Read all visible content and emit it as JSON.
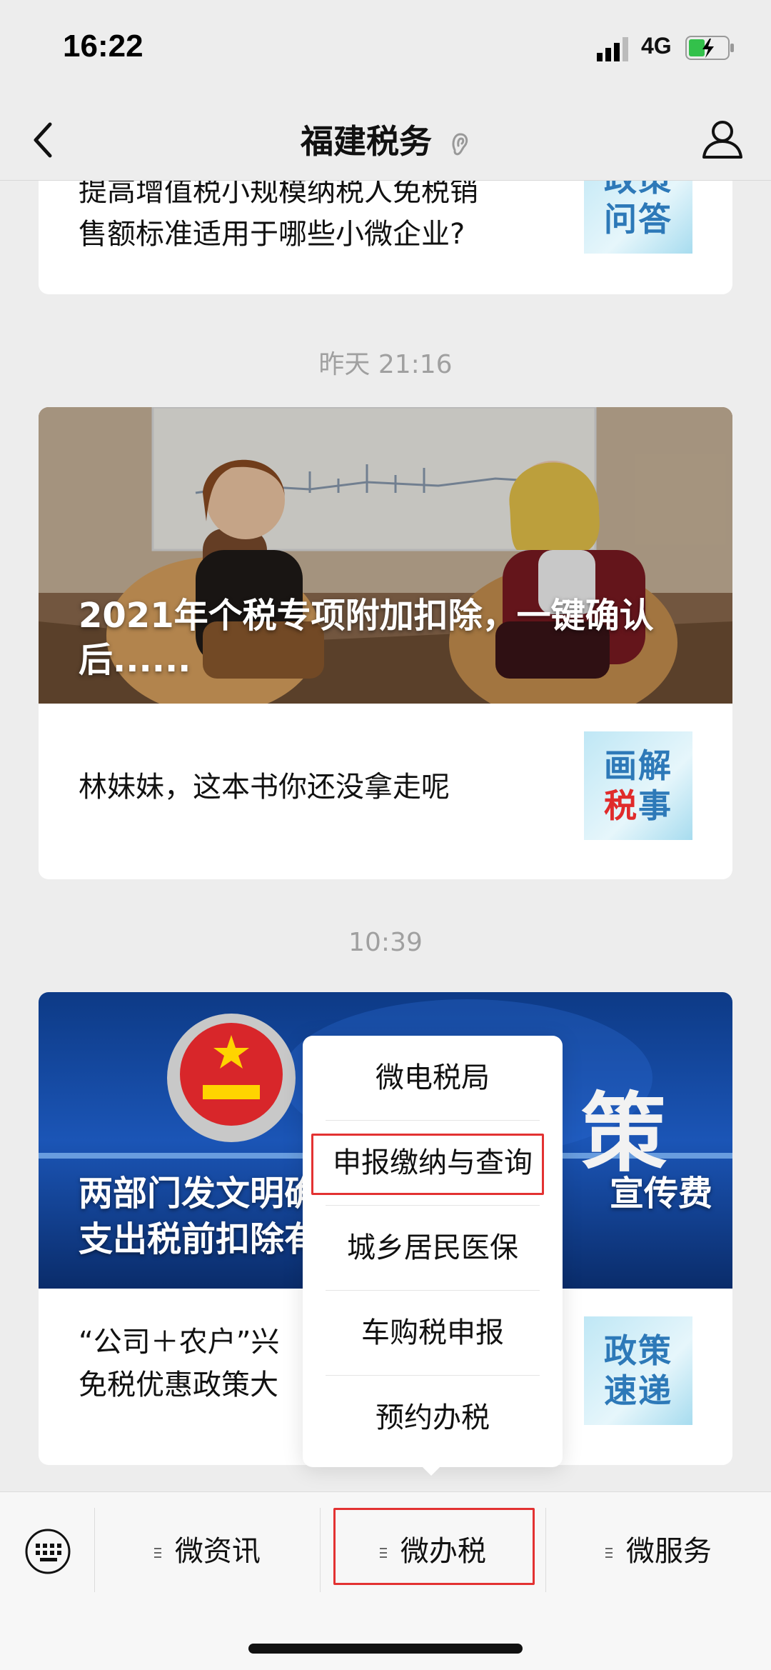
{
  "status": {
    "time": "16:22",
    "network": "4G"
  },
  "nav": {
    "title": "福建税务"
  },
  "card1": {
    "line1": "提高增值税小规模纳税人免税销",
    "line2": "售额标准适用于哪些小微企业?",
    "thumb": [
      "政策",
      "问答"
    ]
  },
  "stamp1": "昨天 21:16",
  "card2": {
    "hero_title": "2021年个税专项附加扣除，一键确认后......",
    "row_text": "林妹妹，这本书你还没拿走呢",
    "thumb": [
      "画解",
      "税",
      "事"
    ]
  },
  "stamp2": "10:39",
  "card3": {
    "hero_title_l1": "两部门发文明确",
    "hero_title_r1": "宣传费",
    "hero_title_l2": "支出税前扣除有",
    "hero_word": "策",
    "row_l1": "“公司＋农户”兴",
    "row_l2": "免税优惠政策大",
    "thumb": [
      "政策",
      "速递"
    ]
  },
  "popup": {
    "items": [
      "微电税局",
      "申报缴纳与查询",
      "城乡居民医保",
      "车购税申报",
      "预约办税"
    ],
    "highlighted_index": 1
  },
  "tabs": [
    {
      "label": "微资讯"
    },
    {
      "label": "微办税",
      "highlighted": true
    },
    {
      "label": "微服务"
    }
  ],
  "colors": {
    "highlight": "#e33232",
    "thumb_text": "#2d79b8"
  }
}
